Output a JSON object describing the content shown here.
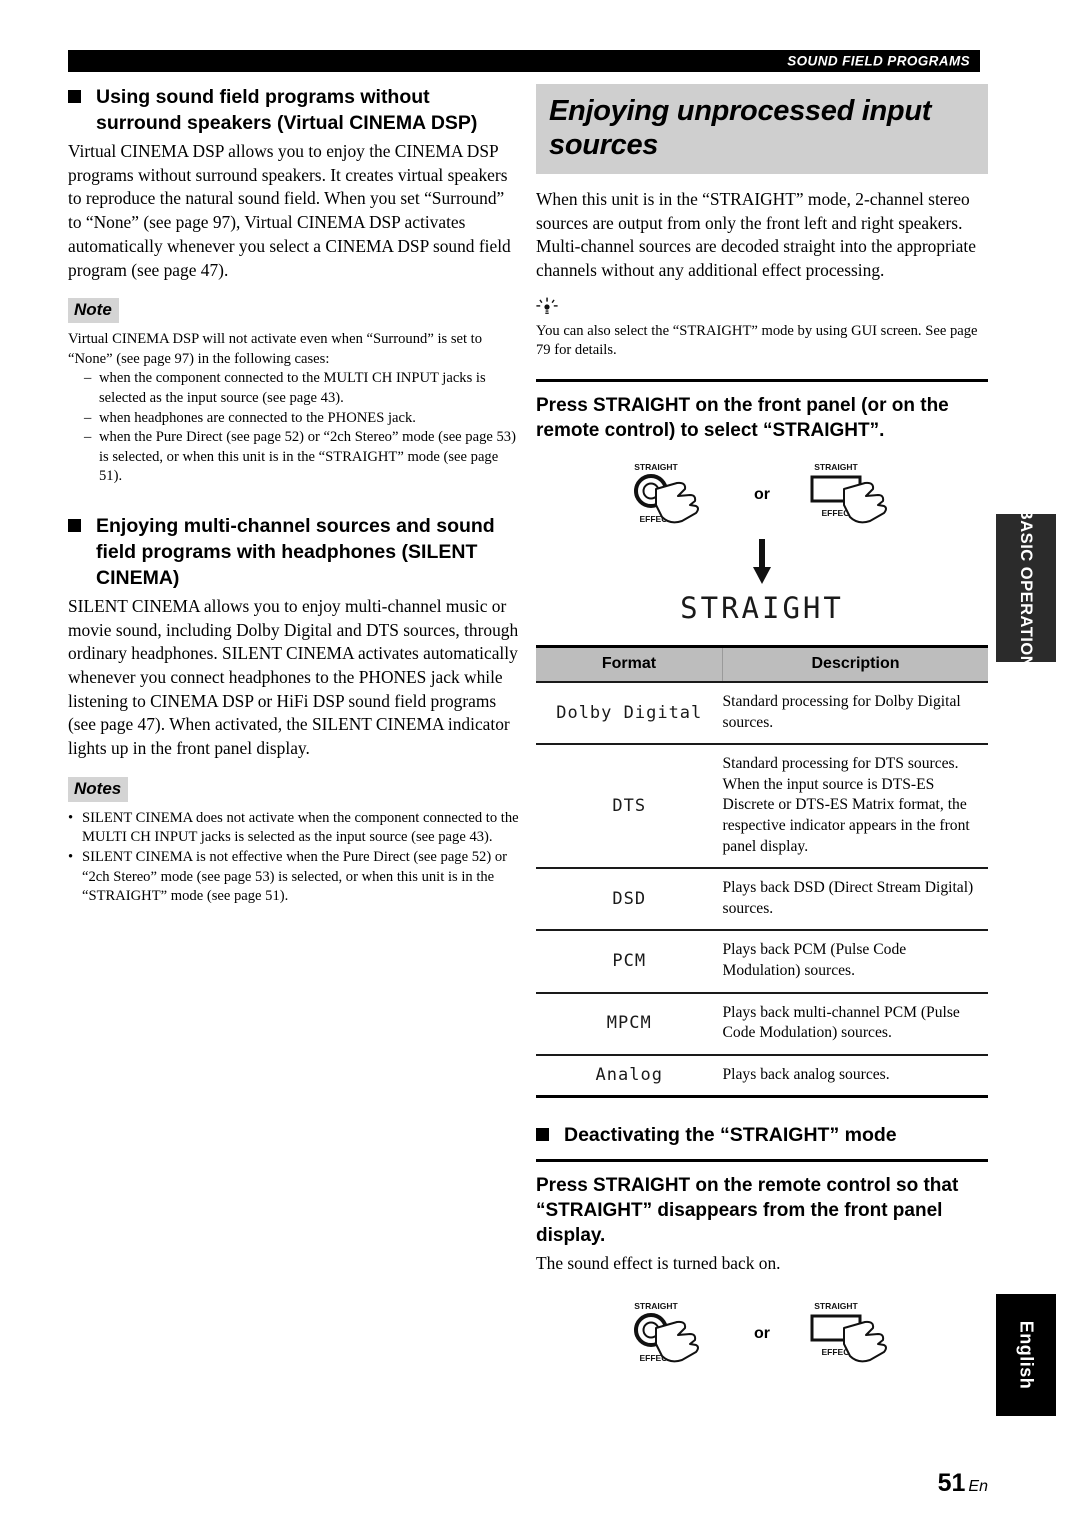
{
  "header": {
    "title": "SOUND FIELD PROGRAMS"
  },
  "left_column": {
    "section1": {
      "heading_lines": "Using sound field programs without surround speakers (Virtual CINEMA DSP)",
      "body": "Virtual CINEMA DSP allows you to enjoy the CINEMA DSP programs without surround speakers. It creates virtual speakers to reproduce the natural sound field. When you set “Surround” to “None” (see page 97), Virtual CINEMA DSP activates automatically whenever you select a CINEMA DSP sound field program (see page 47).",
      "note_label": "Note",
      "note_intro": "Virtual CINEMA DSP will not activate even when “Surround” is set to “None” (see page 97) in the following cases:",
      "note_items": [
        "when the component connected to the MULTI CH INPUT jacks is selected as the input source (see page 43).",
        "when headphones are connected to the PHONES jack.",
        "when the Pure Direct (see page 52) or “2ch Stereo” mode (see page 53) is selected, or when this unit is in the “STRAIGHT” mode (see page 51)."
      ]
    },
    "section2": {
      "heading_lines": "Enjoying multi-channel sources and sound field programs with headphones (SILENT CINEMA)",
      "body": "SILENT CINEMA allows you to enjoy multi-channel music or movie sound, including Dolby Digital and DTS sources, through ordinary headphones. SILENT CINEMA activates automatically whenever you connect headphones to the PHONES jack while listening to CINEMA DSP or HiFi DSP sound field programs (see page 47). When activated, the SILENT CINEMA indicator lights up in the front panel display.",
      "notes_label": "Notes",
      "notes_items": [
        "SILENT CINEMA does not activate when the component connected to the MULTI CH INPUT jacks is selected as the input source (see page 43).",
        "SILENT CINEMA is not effective when the Pure Direct (see page 52) or “2ch Stereo” mode (see page 53) is selected, or when this unit is in the “STRAIGHT” mode (see page 51)."
      ]
    }
  },
  "right_column": {
    "title": "Enjoying unprocessed input sources",
    "intro": "When this unit is in the “STRAIGHT” mode, 2-channel stereo sources are output from only the front left and right speakers. Multi-channel sources are decoded straight into the appropriate channels without any additional effect processing.",
    "tip": "You can also select the “STRAIGHT” mode by using GUI screen. See page 79 for details.",
    "step_heading": "Press STRAIGHT on the front panel (or on the remote control) to select “STRAIGHT”.",
    "button_figure": {
      "knob_top_label": "STRAIGHT",
      "knob_bottom_label": "EFFECT",
      "or_label": "or",
      "remote_top_label": "STRAIGHT",
      "remote_bottom_label": "EFFECT"
    },
    "display_text": "STRAIGHT",
    "table": {
      "columns": [
        "Format",
        "Description"
      ],
      "rows": [
        {
          "format": "Dolby Digital",
          "description": "Standard processing for Dolby Digital sources."
        },
        {
          "format": "DTS",
          "description": "Standard processing for DTS sources. When the input source is DTS-ES Discrete or DTS-ES Matrix format, the respective indicator appears in the front panel display."
        },
        {
          "format": "DSD",
          "description": "Plays back DSD (Direct Stream Digital) sources."
        },
        {
          "format": "PCM",
          "description": "Plays back PCM (Pulse Code Modulation) sources."
        },
        {
          "format": "MPCM",
          "description": "Plays back multi-channel PCM (Pulse Code Modulation) sources."
        },
        {
          "format": "Analog",
          "description": "Plays back analog sources."
        }
      ]
    },
    "deactivate": {
      "heading": "Deactivating the “STRAIGHT” mode",
      "step_heading": "Press STRAIGHT on the remote control so that “STRAIGHT” disappears from the front panel display.",
      "step_body": "The sound effect is turned back on.",
      "button_figure": {
        "knob_top_label": "STRAIGHT",
        "knob_bottom_label": "EFFECT",
        "or_label": "or",
        "remote_top_label": "STRAIGHT",
        "remote_bottom_label": "EFFECT"
      }
    }
  },
  "side_tabs": {
    "basic_operation": "BASIC OPERATION",
    "english": "English"
  },
  "page": {
    "number": "51",
    "suffix": "En"
  }
}
